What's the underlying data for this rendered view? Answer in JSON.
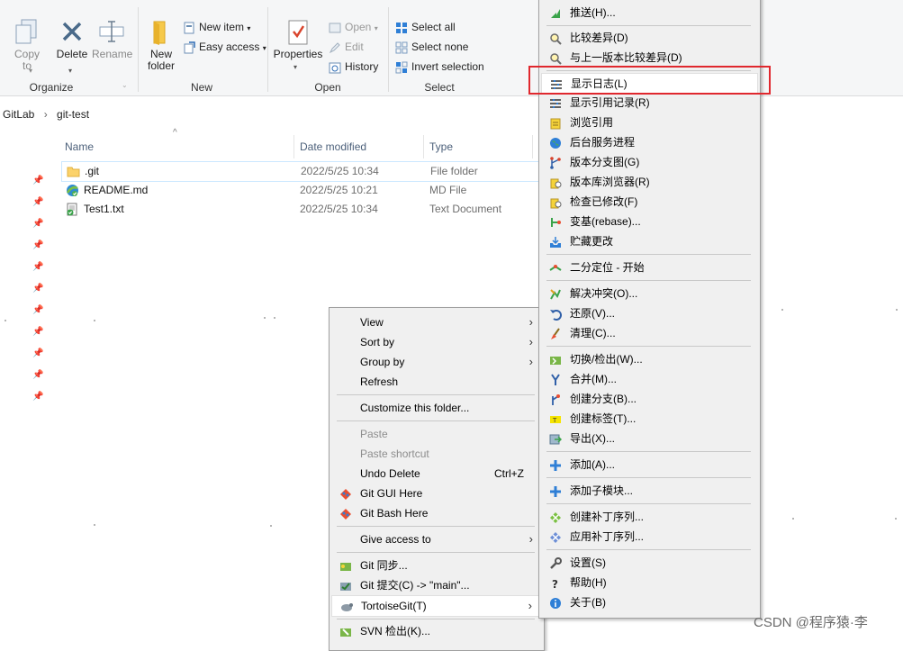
{
  "ribbon": {
    "copy_to": "Copy to",
    "delete": "Delete",
    "rename": "Rename",
    "organize": "Organize",
    "new_folder": "New folder",
    "new_item": "New item",
    "easy_access": "Easy access",
    "new": "New",
    "properties": "Properties",
    "open_btn": "Open",
    "edit": "Edit",
    "history": "History",
    "open_group": "Open",
    "select_all": "Select all",
    "select_none": "Select none",
    "invert_selection": "Invert selection",
    "select_group": "Select"
  },
  "address": {
    "root": "GitLab",
    "current": "git-test"
  },
  "columns": {
    "name": "Name",
    "date": "Date modified",
    "type": "Type"
  },
  "files": [
    {
      "name": ".git",
      "date": "2022/5/25 10:34",
      "type": "File folder"
    },
    {
      "name": "README.md",
      "date": "2022/5/25 10:21",
      "type": "MD File"
    },
    {
      "name": "Test1.txt",
      "date": "2022/5/25 10:34",
      "type": "Text Document"
    }
  ],
  "context_menu": {
    "view": "View",
    "sort_by": "Sort by",
    "group_by": "Group by",
    "refresh": "Refresh",
    "customize": "Customize this folder...",
    "paste": "Paste",
    "paste_shortcut": "Paste shortcut",
    "undo_delete": "Undo Delete",
    "undo_shortcut": "Ctrl+Z",
    "git_gui": "Git GUI Here",
    "git_bash": "Git Bash Here",
    "give_access": "Give access to",
    "git_sync": "Git 同步...",
    "git_commit": "Git 提交(C) -> \"main\"...",
    "tortoisegit": "TortoiseGit(T)",
    "svn_checkout": "SVN 检出(K)..."
  },
  "tortoise_menu": {
    "push": "推送(H)...",
    "diff": "比较差异(D)",
    "diff_prev": "与上一版本比较差异(D)",
    "show_log": "显示日志(L)",
    "show_reflog": "显示引用记录(R)",
    "browse_refs": "浏览引用",
    "daemon": "后台服务进程",
    "revision_graph": "版本分支图(G)",
    "repo_browser": "版本库浏览器(R)",
    "check_mods": "检查已修改(F)",
    "rebase": "变基(rebase)...",
    "stash": "贮藏更改",
    "bisect": "二分定位 - 开始",
    "resolve": "解决冲突(O)...",
    "revert": "还原(V)...",
    "cleanup": "清理(C)...",
    "switch": "切换/检出(W)...",
    "merge": "合并(M)...",
    "create_branch": "创建分支(B)...",
    "create_tag": "创建标签(T)...",
    "export": "导出(X)...",
    "add": "添加(A)...",
    "add_submodule": "添加子模块...",
    "create_patch": "创建补丁序列...",
    "apply_patch": "应用补丁序列...",
    "settings": "设置(S)",
    "help": "帮助(H)",
    "about": "关于(B)"
  },
  "watermark": "CSDN @程序猿·李",
  "colors": {
    "highlight_box": "#e0282e",
    "accent": "#0063b1"
  }
}
